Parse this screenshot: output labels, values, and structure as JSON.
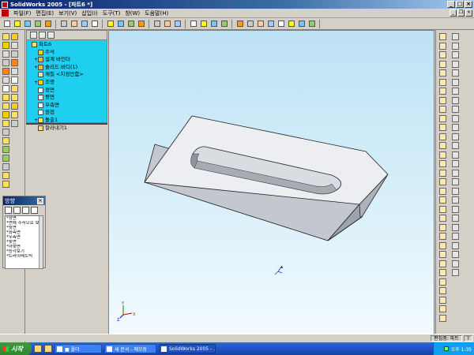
{
  "window": {
    "title": "SolidWorks 2005 - [파트6 *]"
  },
  "menus": [
    "파일(F)",
    "편집(E)",
    "보기(V)",
    "삽입(I)",
    "도구(T)",
    "창(W)",
    "도움말(H)"
  ],
  "toolbar": {
    "icons": [
      "new-icon",
      "open-icon",
      "save-icon",
      "print-icon",
      "print-preview-icon",
      "cut-icon",
      "copy-icon",
      "paste-icon",
      "undo-icon",
      "select-icon",
      "rebuild-icon",
      "options-icon",
      "help-icon",
      "view-icon",
      "zoom-fit-icon",
      "zoom-area-icon",
      "zoom-icon",
      "rotate-icon",
      "pan-icon",
      "display-icon",
      "section-icon",
      "wireframe-icon",
      "hidden-lines-icon",
      "shaded-icon",
      "shaded-edges-icon",
      "shadow-icon",
      "perspective-icon",
      "standard-views-icon"
    ]
  },
  "feature_tree": {
    "items": [
      {
        "label": "파트6",
        "icon": "part-icon",
        "level": 0,
        "expander": ""
      },
      {
        "label": "주석",
        "icon": "annotations-icon",
        "level": 1,
        "expander": ""
      },
      {
        "label": "설계 바인더",
        "icon": "design-binder-icon",
        "level": 1,
        "expander": "+"
      },
      {
        "label": "솔리드 바디(1)",
        "icon": "solid-bodies-icon",
        "level": 1,
        "expander": "+"
      },
      {
        "label": "재질 <지정안함>",
        "icon": "material-icon",
        "level": 1,
        "expander": ""
      },
      {
        "label": "조명",
        "icon": "lighting-folder-icon",
        "level": 1,
        "expander": "+"
      },
      {
        "label": "정면",
        "icon": "plane-icon",
        "level": 1,
        "expander": ""
      },
      {
        "label": "평면",
        "icon": "plane-icon",
        "level": 1,
        "expander": ""
      },
      {
        "label": "우측면",
        "icon": "plane-icon",
        "level": 1,
        "expander": ""
      },
      {
        "label": "원점",
        "icon": "origin-icon",
        "level": 1,
        "expander": ""
      },
      {
        "label": "돌출1",
        "icon": "extrude-icon",
        "level": 1,
        "expander": "+"
      },
      {
        "label": "잘라내기1",
        "icon": "cut-extrude-icon",
        "level": 1,
        "expander": ""
      }
    ]
  },
  "palette": {
    "title": "방향",
    "items": [
      "*정면",
      "*면에 수직으로 보기",
      "*뒷면",
      "*좌측면",
      "*우측면",
      "*윗면",
      "*아랫면",
      "*등각보기",
      "*트라이메트릭"
    ]
  },
  "statusbar": {
    "left_label": "편집중: 파트",
    "right_label": "?"
  },
  "taskbar": {
    "start_label": "시작",
    "tasks": [
      {
        "label": "■ 폴더",
        "active": false
      },
      {
        "label": "새 문서 - 메모장",
        "active": false
      },
      {
        "label": "SolidWorks 2005 - ...",
        "active": true
      }
    ],
    "clock": "오후 1:35"
  },
  "colors": {
    "tree_background": "#1fcfef",
    "title_bar": "#0a246a",
    "canvas_top": "#bde2f5",
    "model_top": "#e9ecef",
    "model_side": "#b8bcc6"
  }
}
